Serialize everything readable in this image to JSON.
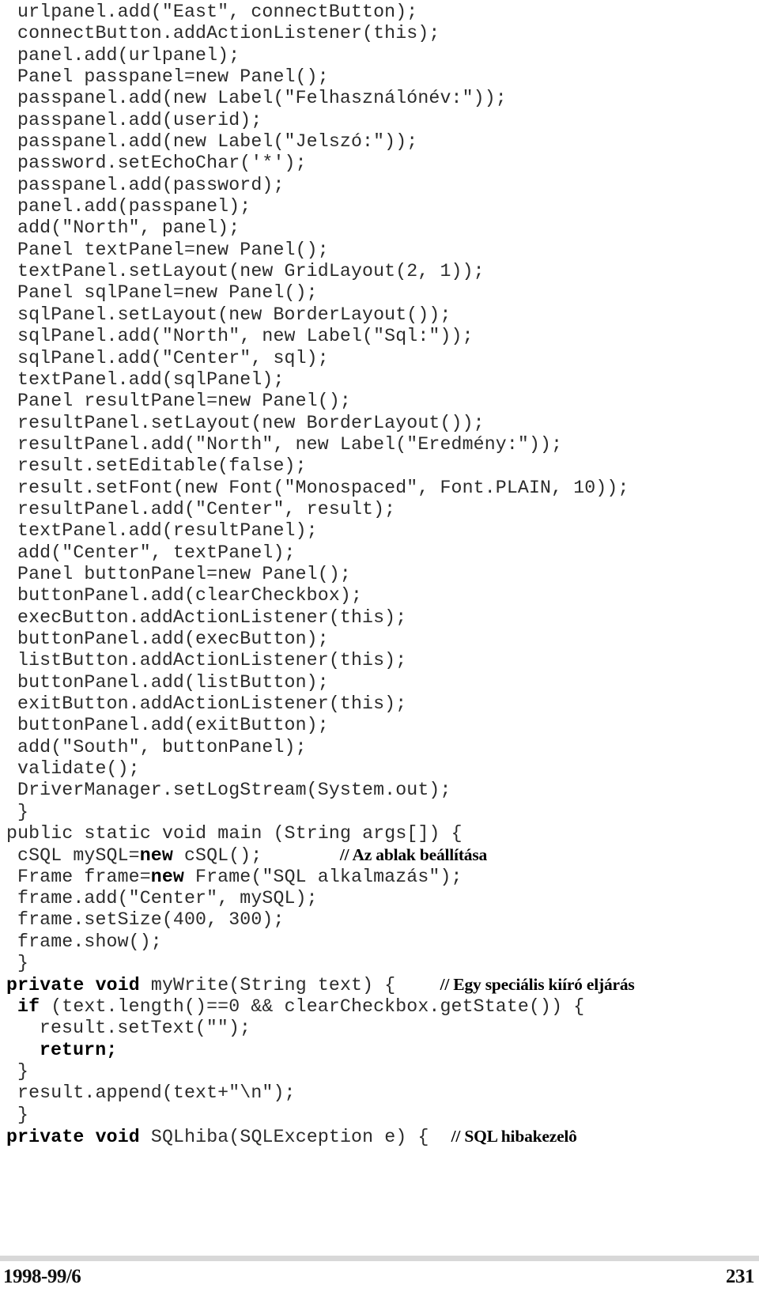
{
  "document": {
    "type": "code-listing",
    "language": "Java",
    "text_color": "#2b2b2b",
    "comment_color": "#000000",
    "rule_color": "#d8d8d8"
  },
  "listing": {
    "lines": [
      {
        "indent": 0,
        "segments": [
          {
            "kind": "code",
            "text": "urlpanel.add(\"East\", connectButton);"
          }
        ]
      },
      {
        "indent": 0,
        "segments": [
          {
            "kind": "code",
            "text": "connectButton.addActionListener(this);"
          }
        ]
      },
      {
        "indent": 0,
        "segments": [
          {
            "kind": "code",
            "text": "panel.add(urlpanel);"
          }
        ]
      },
      {
        "indent": 0,
        "segments": [
          {
            "kind": "code",
            "text": "Panel passpanel=new Panel();"
          }
        ]
      },
      {
        "indent": 0,
        "segments": [
          {
            "kind": "code",
            "text": "passpanel.add(new Label(\"Felhasználónév:\"));"
          }
        ]
      },
      {
        "indent": 0,
        "segments": [
          {
            "kind": "code",
            "text": "passpanel.add(userid);"
          }
        ]
      },
      {
        "indent": 0,
        "segments": [
          {
            "kind": "code",
            "text": "passpanel.add(new Label(\"Jelszó:\"));"
          }
        ]
      },
      {
        "indent": 0,
        "segments": [
          {
            "kind": "code",
            "text": "password.setEchoChar('*');"
          }
        ]
      },
      {
        "indent": 0,
        "segments": [
          {
            "kind": "code",
            "text": "passpanel.add(password);"
          }
        ]
      },
      {
        "indent": 0,
        "segments": [
          {
            "kind": "code",
            "text": "panel.add(passpanel);"
          }
        ]
      },
      {
        "indent": 0,
        "segments": [
          {
            "kind": "code",
            "text": "add(\"North\", panel);"
          }
        ]
      },
      {
        "indent": 0,
        "segments": [
          {
            "kind": "code",
            "text": "Panel textPanel=new Panel();"
          }
        ]
      },
      {
        "indent": 0,
        "segments": [
          {
            "kind": "code",
            "text": "textPanel.setLayout(new GridLayout(2, 1));"
          }
        ]
      },
      {
        "indent": 0,
        "segments": [
          {
            "kind": "code",
            "text": "Panel sqlPanel=new Panel();"
          }
        ]
      },
      {
        "indent": 0,
        "segments": [
          {
            "kind": "code",
            "text": "sqlPanel.setLayout(new BorderLayout());"
          }
        ]
      },
      {
        "indent": 0,
        "segments": [
          {
            "kind": "code",
            "text": "sqlPanel.add(\"North\", new Label(\"Sql:\"));"
          }
        ]
      },
      {
        "indent": 0,
        "segments": [
          {
            "kind": "code",
            "text": "sqlPanel.add(\"Center\", sql);"
          }
        ]
      },
      {
        "indent": 0,
        "segments": [
          {
            "kind": "code",
            "text": "textPanel.add(sqlPanel);"
          }
        ]
      },
      {
        "indent": 0,
        "segments": [
          {
            "kind": "code",
            "text": "Panel resultPanel=new Panel();"
          }
        ]
      },
      {
        "indent": 0,
        "segments": [
          {
            "kind": "code",
            "text": "resultPanel.setLayout(new BorderLayout());"
          }
        ]
      },
      {
        "indent": 0,
        "segments": [
          {
            "kind": "code",
            "text": "resultPanel.add(\"North\", new Label(\"Eredmény:\"));"
          }
        ]
      },
      {
        "indent": 0,
        "segments": [
          {
            "kind": "code",
            "text": "result.setEditable(false);"
          }
        ]
      },
      {
        "indent": 0,
        "segments": [
          {
            "kind": "code",
            "text": "result.setFont(new Font(\"Monospaced\", Font.PLAIN, 10));"
          }
        ]
      },
      {
        "indent": 0,
        "segments": [
          {
            "kind": "code",
            "text": "resultPanel.add(\"Center\", result);"
          }
        ]
      },
      {
        "indent": 0,
        "segments": [
          {
            "kind": "code",
            "text": "textPanel.add(resultPanel);"
          }
        ]
      },
      {
        "indent": 0,
        "segments": [
          {
            "kind": "code",
            "text": "add(\"Center\", textPanel);"
          }
        ]
      },
      {
        "indent": 0,
        "segments": [
          {
            "kind": "code",
            "text": "Panel buttonPanel=new Panel();"
          }
        ]
      },
      {
        "indent": 0,
        "segments": [
          {
            "kind": "code",
            "text": "buttonPanel.add(clearCheckbox);"
          }
        ]
      },
      {
        "indent": 0,
        "segments": [
          {
            "kind": "code",
            "text": "execButton.addActionListener(this);"
          }
        ]
      },
      {
        "indent": 0,
        "segments": [
          {
            "kind": "code",
            "text": "buttonPanel.add(execButton);"
          }
        ]
      },
      {
        "indent": 0,
        "segments": [
          {
            "kind": "code",
            "text": "listButton.addActionListener(this);"
          }
        ]
      },
      {
        "indent": 0,
        "segments": [
          {
            "kind": "code",
            "text": "buttonPanel.add(listButton);"
          }
        ]
      },
      {
        "indent": 0,
        "segments": [
          {
            "kind": "code",
            "text": "exitButton.addActionListener(this);"
          }
        ]
      },
      {
        "indent": 0,
        "segments": [
          {
            "kind": "code",
            "text": "buttonPanel.add(exitButton);"
          }
        ]
      },
      {
        "indent": 0,
        "segments": [
          {
            "kind": "code",
            "text": "add(\"South\", buttonPanel);"
          }
        ]
      },
      {
        "indent": 0,
        "segments": [
          {
            "kind": "code",
            "text": "validate();"
          }
        ]
      },
      {
        "indent": 0,
        "segments": [
          {
            "kind": "code",
            "text": "DriverManager.setLogStream(System.out);"
          }
        ]
      },
      {
        "indent": 0,
        "segments": [
          {
            "kind": "code",
            "text": "}"
          }
        ]
      },
      {
        "indent": -1,
        "segments": [
          {
            "kind": "code",
            "text": "public static void main (String args[]) {"
          }
        ]
      },
      {
        "indent": 0,
        "segments": [
          {
            "kind": "code",
            "text": "cSQL mySQL="
          },
          {
            "kind": "keyword",
            "text": "new"
          },
          {
            "kind": "code",
            "text": " cSQL();       "
          },
          {
            "kind": "comment",
            "text": "// Az ablak beállítása"
          }
        ]
      },
      {
        "indent": 0,
        "segments": [
          {
            "kind": "code",
            "text": "Frame frame="
          },
          {
            "kind": "keyword",
            "text": "new"
          },
          {
            "kind": "code",
            "text": " Frame(\"SQL alkalmazás\");"
          }
        ]
      },
      {
        "indent": 0,
        "segments": [
          {
            "kind": "code",
            "text": "frame.add(\"Center\", mySQL);"
          }
        ]
      },
      {
        "indent": 0,
        "segments": [
          {
            "kind": "code",
            "text": "frame.setSize(400, 300);"
          }
        ]
      },
      {
        "indent": 0,
        "segments": [
          {
            "kind": "code",
            "text": "frame.show();"
          }
        ]
      },
      {
        "indent": 0,
        "segments": [
          {
            "kind": "code",
            "text": "}"
          }
        ]
      },
      {
        "indent": -1,
        "segments": [
          {
            "kind": "keyword",
            "text": "private void"
          },
          {
            "kind": "code",
            "text": " myWrite(String text) {    "
          },
          {
            "kind": "comment",
            "text": "// Egy speciális kiíró eljárás"
          }
        ]
      },
      {
        "indent": 0,
        "segments": [
          {
            "kind": "keyword",
            "text": "if"
          },
          {
            "kind": "code",
            "text": " (text.length()==0 && clearCheckbox.getState()) {"
          }
        ]
      },
      {
        "indent": 2,
        "segments": [
          {
            "kind": "code",
            "text": "result.setText(\"\");"
          }
        ]
      },
      {
        "indent": 2,
        "segments": [
          {
            "kind": "keyword",
            "text": "return;"
          }
        ]
      },
      {
        "indent": 0,
        "segments": [
          {
            "kind": "code",
            "text": "}"
          }
        ]
      },
      {
        "indent": 0,
        "segments": [
          {
            "kind": "code",
            "text": "result.append(text+\"\\n\");"
          }
        ]
      },
      {
        "indent": 0,
        "segments": [
          {
            "kind": "code",
            "text": "}"
          }
        ]
      },
      {
        "indent": -1,
        "segments": [
          {
            "kind": "keyword",
            "text": "private void"
          },
          {
            "kind": "code",
            "text": " SQLhiba(SQLException e) {  "
          },
          {
            "kind": "comment",
            "text": "// SQL hibakezelô"
          }
        ]
      }
    ]
  },
  "footer": {
    "issue": "1998-99/6",
    "page_number": "231"
  }
}
